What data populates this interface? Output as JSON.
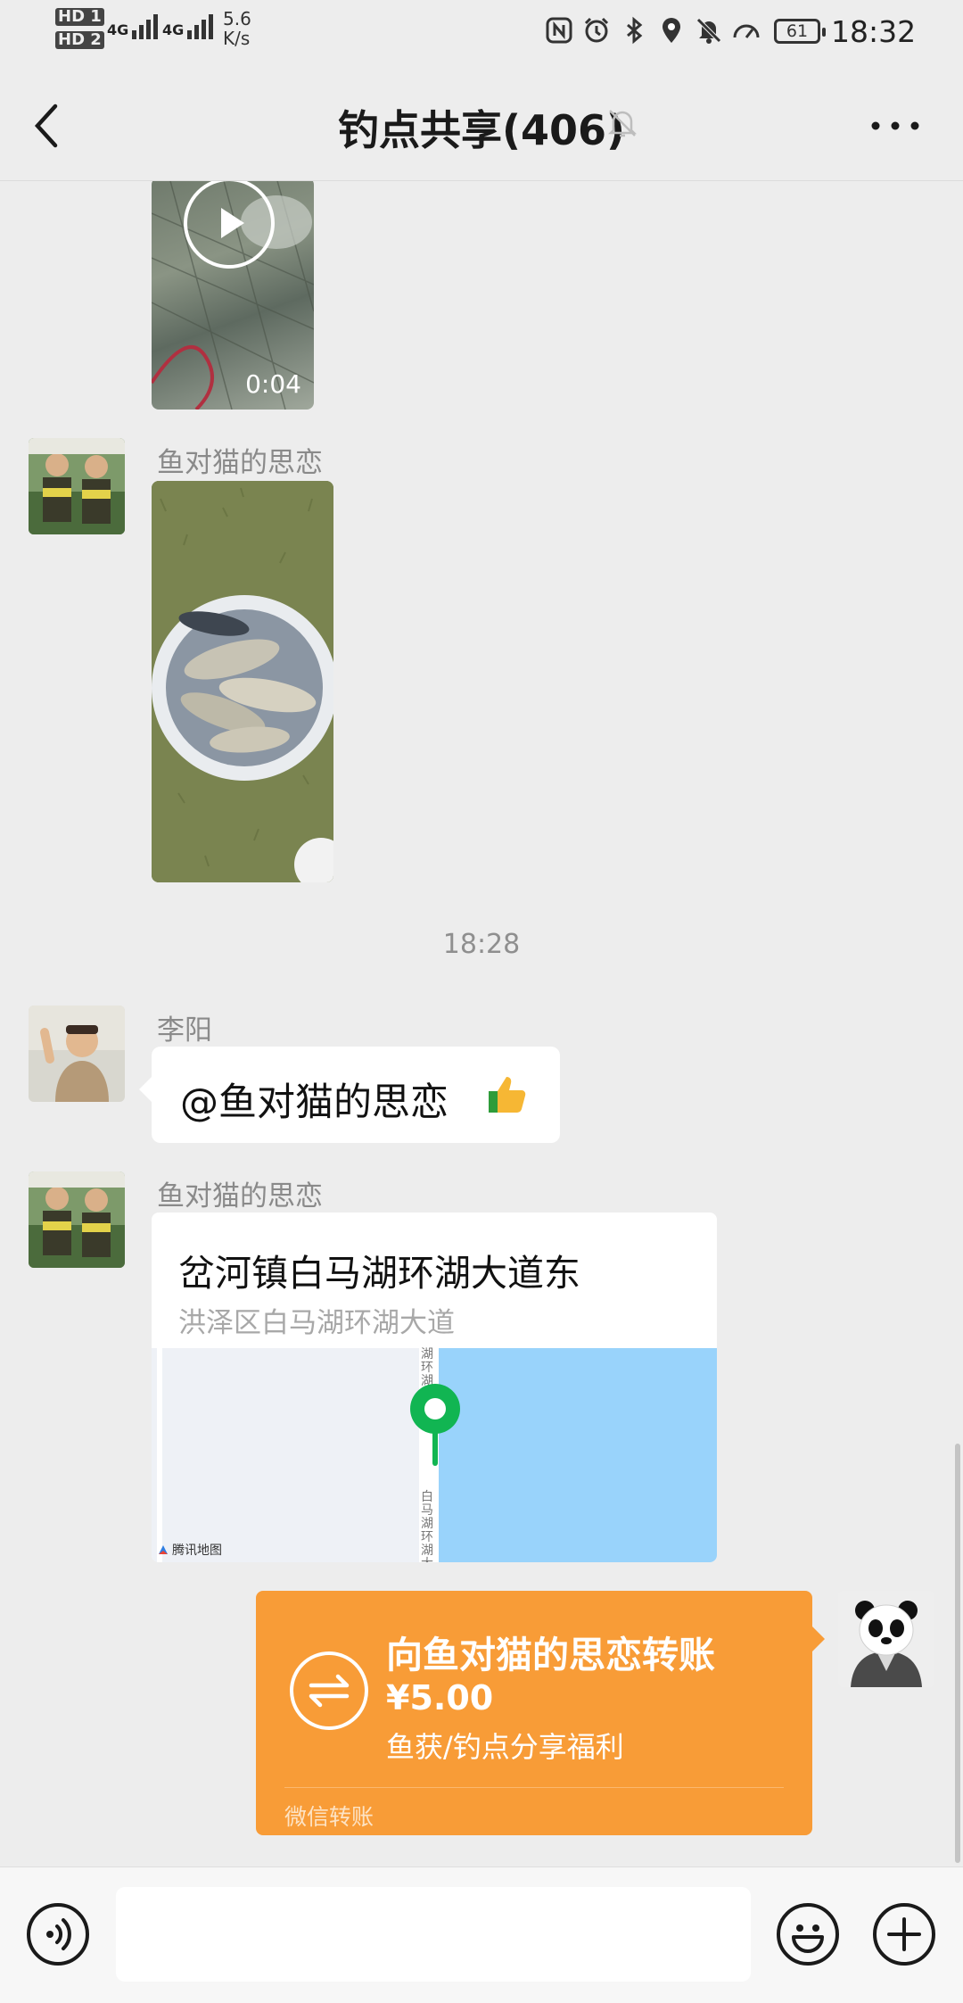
{
  "status_bar": {
    "sim1": "HD 1",
    "sim2": "HD 2",
    "network1": "4G",
    "network2": "4G",
    "speed_value": "5.6",
    "speed_unit": "K/s",
    "battery": "61",
    "time": "18:32",
    "icons": [
      "nfc-icon",
      "alarm-icon",
      "bluetooth-icon",
      "location-icon",
      "mute-icon",
      "speedometer-icon",
      "battery-icon"
    ]
  },
  "header": {
    "title": "钓点共享(406)",
    "back_icon": "chevron-left-icon",
    "muted_icon": "bell-off-icon",
    "more_icon": "more-dots-icon"
  },
  "messages": {
    "video": {
      "duration": "0:04"
    },
    "photo_message": {
      "sender": "鱼对猫的思恋"
    },
    "timestamp": "18:28",
    "text_message": {
      "sender": "李阳",
      "text": "@鱼对猫的思恋",
      "emoji": "👍"
    },
    "location_message": {
      "sender": "鱼对猫的思恋",
      "title": "岔河镇白马湖环湖大道东",
      "address": "洪泽区白马湖环湖大道",
      "map_road_top": "湖环湖",
      "map_road_bottom": "白马湖环湖大",
      "map_brand": "腾讯地图"
    },
    "transfer_message": {
      "title": "向鱼对猫的思恋转账",
      "amount": "¥5.00",
      "note": "鱼获/钓点分享福利",
      "footer": "微信转账"
    }
  },
  "input_bar": {
    "voice_icon": "voice-icon",
    "emoji_icon": "emoji-icon",
    "plus_icon": "plus-icon",
    "text_value": ""
  },
  "colors": {
    "background": "#ededed",
    "transfer_orange": "#f89c37",
    "map_water": "#99d3fb",
    "location_pin": "#11b552"
  }
}
